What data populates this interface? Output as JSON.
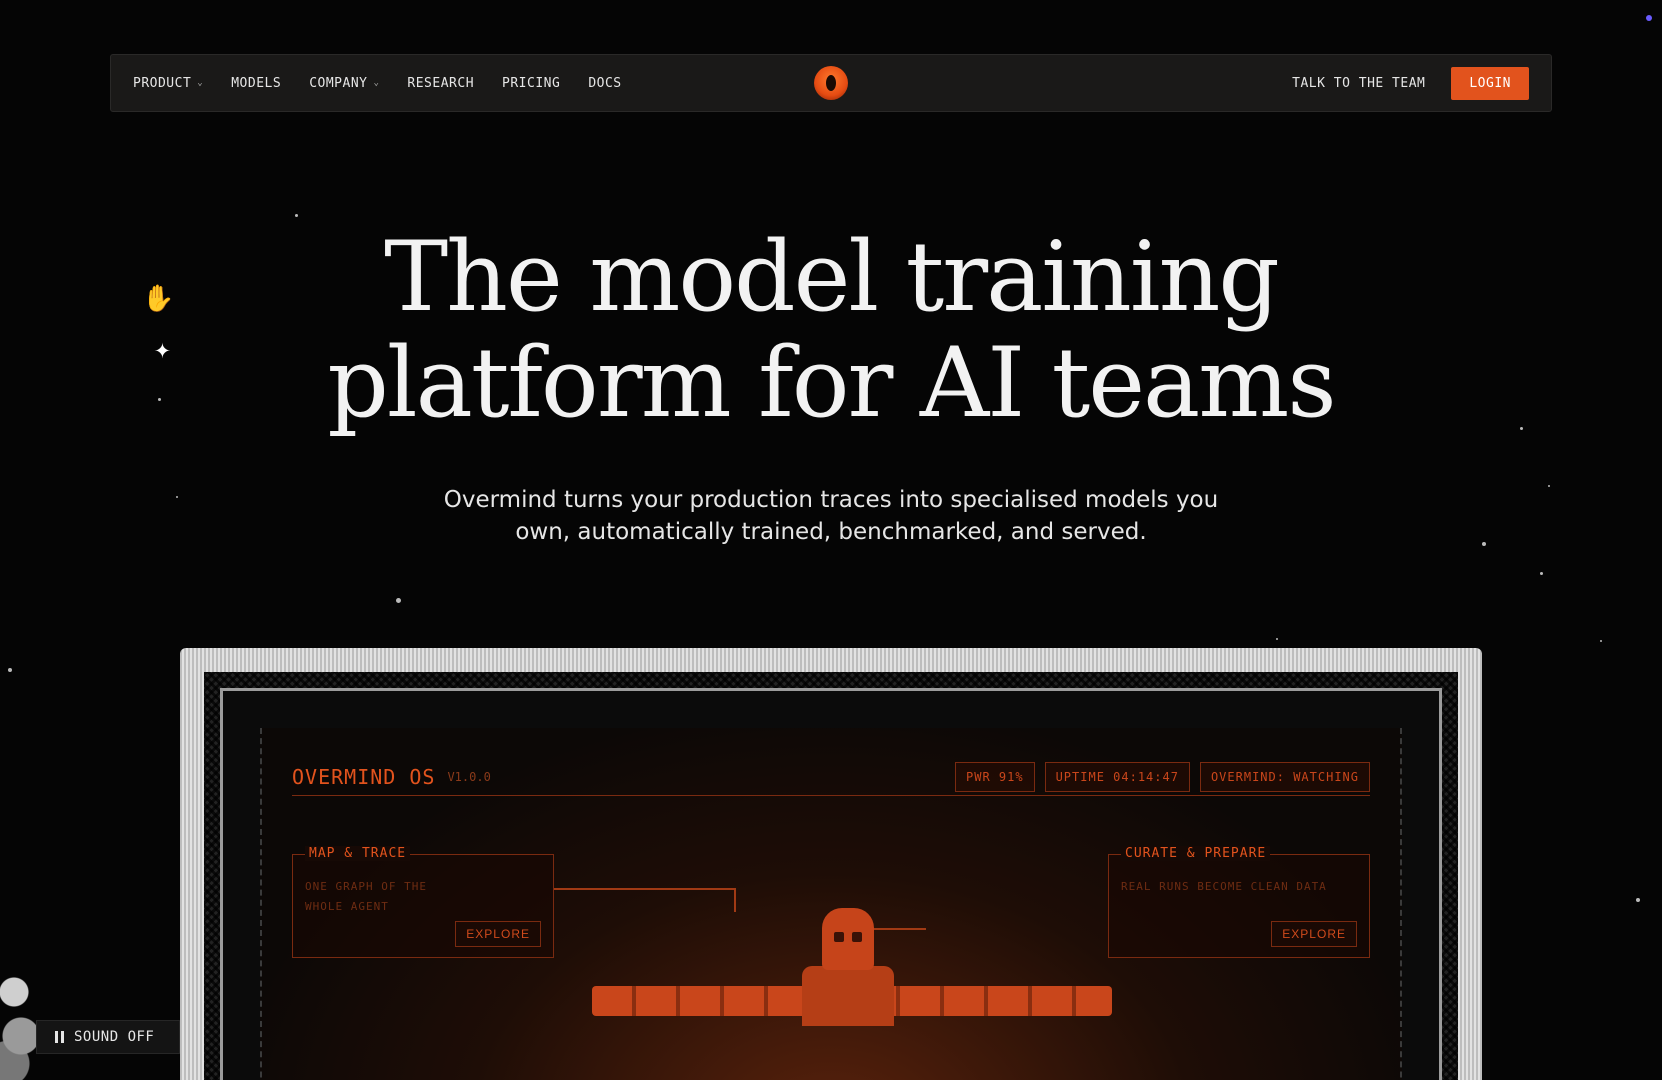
{
  "nav": {
    "items": [
      {
        "label": "PRODUCT",
        "has_dropdown": true
      },
      {
        "label": "MODELS",
        "has_dropdown": false
      },
      {
        "label": "COMPANY",
        "has_dropdown": true
      },
      {
        "label": "RESEARCH",
        "has_dropdown": false
      },
      {
        "label": "PRICING",
        "has_dropdown": false
      },
      {
        "label": "DOCS",
        "has_dropdown": false
      }
    ],
    "talk_label": "TALK TO THE TEAM",
    "login_label": "LOGIN"
  },
  "hero": {
    "title_line1": "The model training",
    "title_line2": "platform for AI teams",
    "subtitle_line1": "Overmind turns your production traces into specialised models you",
    "subtitle_line2": "own, automatically trained, benchmarked, and served."
  },
  "os": {
    "title": "OVERMIND OS",
    "version": "V1.0.0",
    "stats": [
      "PWR 91%",
      "UPTIME 04:14:47",
      "OVERMIND: WATCHING"
    ],
    "panels": [
      {
        "title": "MAP & TRACE",
        "desc": "ONE GRAPH OF THE WHOLE AGENT",
        "button": "EXPLORE"
      },
      {
        "title": "CURATE & PREPARE",
        "desc": "REAL RUNS BECOME CLEAN DATA",
        "button": "EXPLORE"
      }
    ]
  },
  "sound": {
    "label": "SOUND OFF"
  },
  "colors": {
    "accent": "#e2531d",
    "background": "#050505",
    "nav_bg": "#1a1918"
  }
}
